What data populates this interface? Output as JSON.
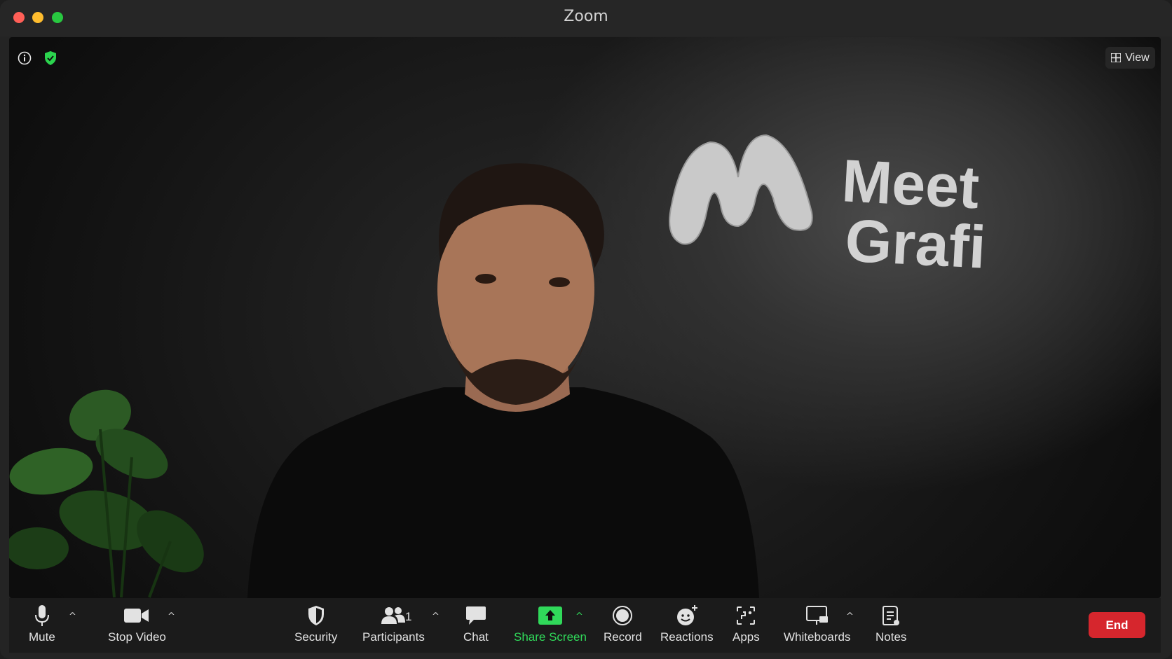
{
  "window": {
    "title": "Zoom"
  },
  "video": {
    "logo_line1": "Meet",
    "logo_line2": "Grafi",
    "view_label": "View"
  },
  "toolbar": {
    "mute": "Mute",
    "stop_video": "Stop Video",
    "security": "Security",
    "participants": "Participants",
    "participants_count": "1",
    "chat": "Chat",
    "share_screen": "Share Screen",
    "record": "Record",
    "reactions": "Reactions",
    "apps": "Apps",
    "whiteboards": "Whiteboards",
    "notes": "Notes",
    "end": "End"
  },
  "colors": {
    "share_green": "#30d95a",
    "end_red": "#d6262d",
    "shield_green": "#2bd44e"
  }
}
